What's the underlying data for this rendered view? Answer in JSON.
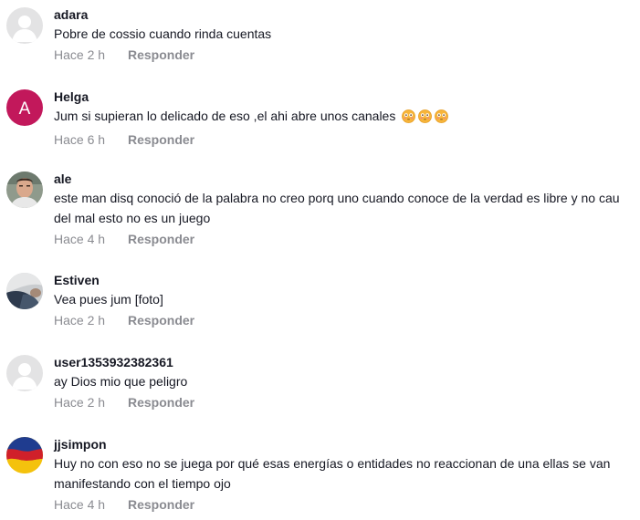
{
  "comments": [
    {
      "username": "adara",
      "text": "Pobre de cossio cuando rinda cuentas",
      "time": "Hace 2 h",
      "reply_label": "Responder",
      "avatar": "default-avatar-icon"
    },
    {
      "username": "Helga",
      "text": "Jum si supieran lo delicado de eso ,el ahi abre unos canales",
      "time": "Hace 6 h",
      "reply_label": "Responder",
      "avatar": "letter-avatar",
      "avatar_letter": "A",
      "avatar_color": "#c2185b",
      "emojis": [
        "flushed-face-emoji",
        "flushed-face-emoji",
        "flushed-face-emoji"
      ]
    },
    {
      "username": "ale",
      "text_line1": "este man disq conoció de la palabra no creo porq uno cuando conoce de la verdad es libre y no cau",
      "text_line2": "del mal esto no es un juego",
      "time": "Hace 4 h",
      "reply_label": "Responder",
      "avatar": "photo-avatar"
    },
    {
      "username": "Estiven",
      "text": "Vea pues jum [foto]",
      "time": "Hace 2 h",
      "reply_label": "Responder",
      "avatar": "photo-avatar"
    },
    {
      "username": "user1353932382361",
      "text": "ay Dios mio que peligro",
      "time": "Hace 2 h",
      "reply_label": "Responder",
      "avatar": "default-avatar-icon"
    },
    {
      "username": "jjsimpon",
      "text_line1": "Huy no con eso no se juega por qué esas energías o entidades no reaccionan de una ellas se van",
      "text_line2": "manifestando con el tiempo ojo",
      "time": "Hace 4 h",
      "reply_label": "Responder",
      "avatar": "flag-avatar"
    }
  ],
  "colors": {
    "text": "#161823",
    "meta": "#8a8b91",
    "default_avatar_bg": "#e3e3e4",
    "flag_yellow": "#f4c20d",
    "flag_blue": "#1f3c8f",
    "flag_red": "#d0202a"
  }
}
